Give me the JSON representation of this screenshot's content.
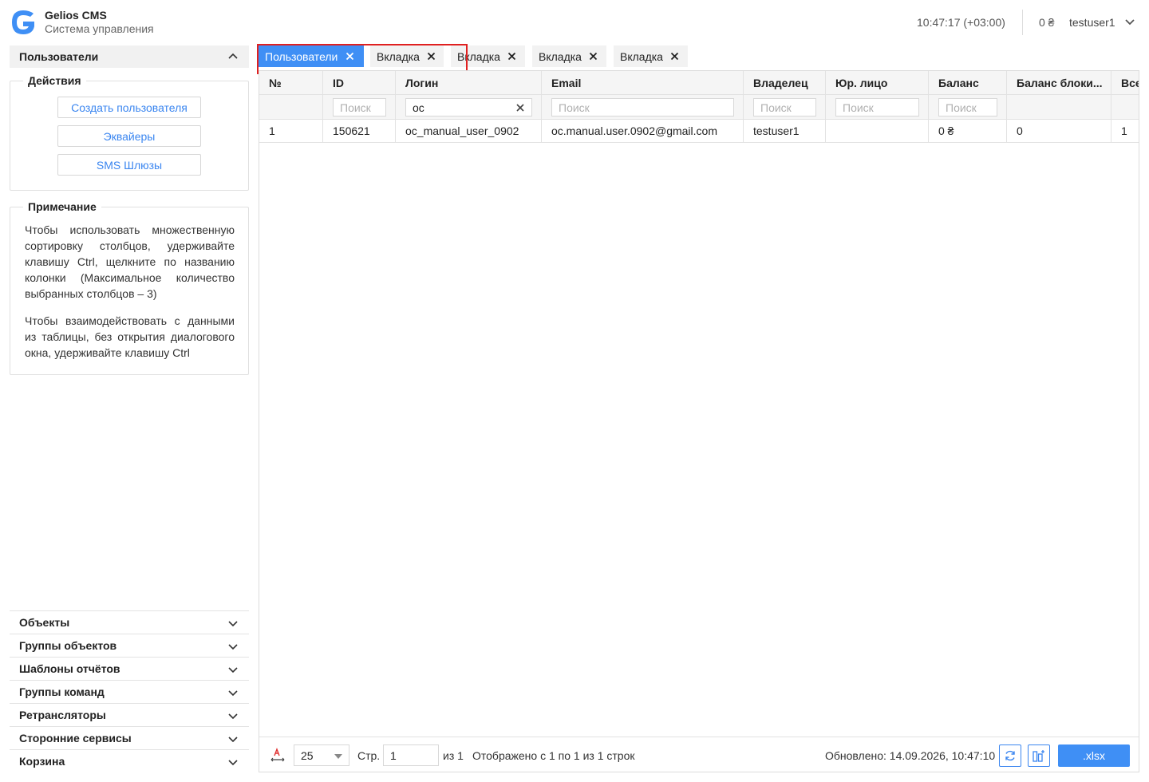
{
  "header": {
    "brand_title": "Gelios CMS",
    "brand_subtitle": "Система управления",
    "clock": "10:47:17 (+03:00)",
    "balance": "0 ₴",
    "username": "testuser1"
  },
  "sidebar": {
    "section_title": "Пользователи",
    "actions_legend": "Действия",
    "action_buttons": [
      "Создать пользователя",
      "Эквайеры",
      "SMS Шлюзы"
    ],
    "note_legend": "Примечание",
    "note_paragraphs": [
      "Чтобы использовать множественную сортировку столбцов, удерживайте клавишу Ctrl, щелкните по названию колонки (Максимальное количество выбранных столбцов – 3)",
      "Чтобы взаимодействовать с данными из таблицы, без открытия диалогового окна, удерживайте клавишу Ctrl"
    ],
    "sections": [
      "Объекты",
      "Группы объектов",
      "Шаблоны отчётов",
      "Группы команд",
      "Ретрансляторы",
      "Сторонние сервисы",
      "Корзина"
    ]
  },
  "tabs": [
    {
      "label": "Пользователи",
      "active": true
    },
    {
      "label": "Вкладка",
      "active": false
    },
    {
      "label": "Вкладка",
      "active": false
    },
    {
      "label": "Вкладка",
      "active": false
    },
    {
      "label": "Вкладка",
      "active": false
    }
  ],
  "table": {
    "columns": [
      "№",
      "ID",
      "Логин",
      "Email",
      "Владелец",
      "Юр. лицо",
      "Баланс",
      "Баланс блоки...",
      "Все"
    ],
    "filter_placeholder": "Поиск",
    "login_filter_value": "oc",
    "rows": [
      [
        "1",
        "150621",
        "oc_manual_user_0902",
        "oc.manual.user.0902@gmail.com",
        "testuser1",
        "",
        "0 ₴",
        "0",
        "1"
      ]
    ]
  },
  "footer": {
    "page_size": "25",
    "page_label": "Стр.",
    "page_value": "1",
    "of_total": "из 1",
    "shown": "Отображено с 1 по 1 из 1 строк",
    "updated": "Обновлено: 14.09.2026, 10:47:10",
    "export_label": ".xlsx"
  },
  "colors": {
    "accent": "#3f8ff5",
    "highlight": "#e02020"
  }
}
